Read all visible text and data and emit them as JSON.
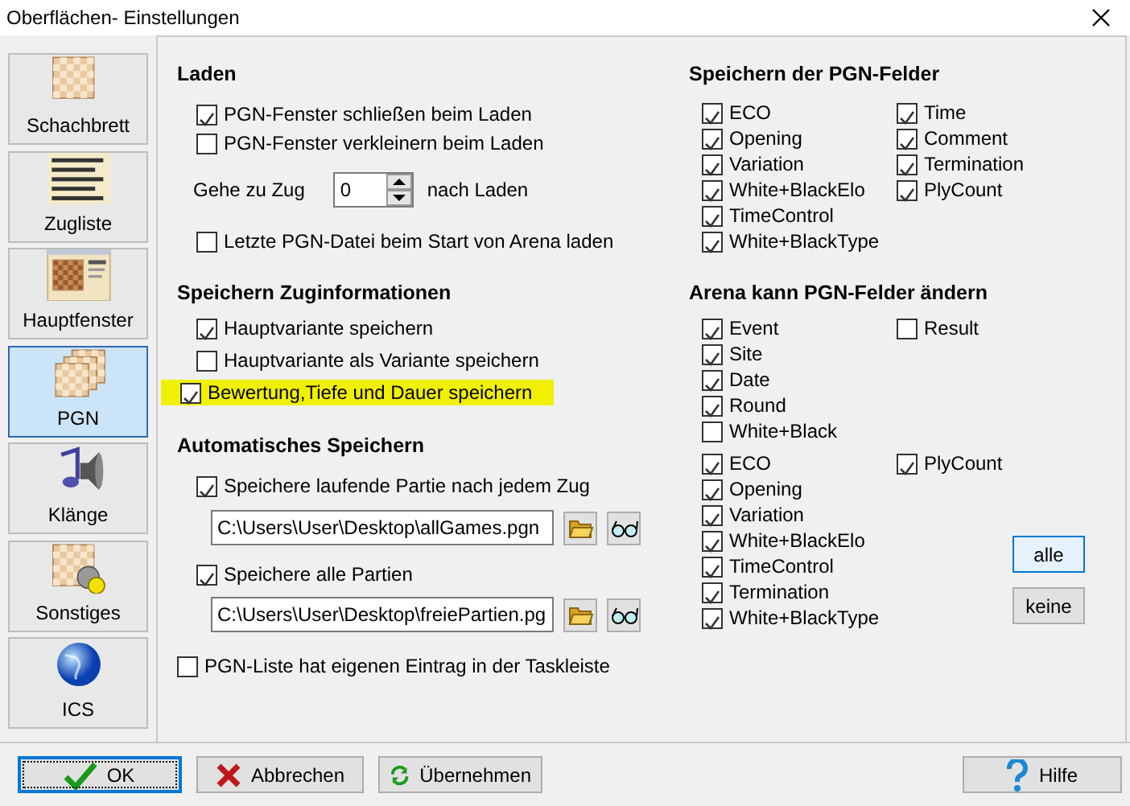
{
  "window": {
    "title": "Oberflächen- Einstellungen"
  },
  "sidebar": {
    "items": [
      {
        "label": "Schachbrett",
        "kind": "board",
        "selected": false
      },
      {
        "label": "Zugliste",
        "kind": "movelist",
        "selected": false
      },
      {
        "label": "Hauptfenster",
        "kind": "mainwindow",
        "selected": false
      },
      {
        "label": "PGN",
        "kind": "pgn",
        "selected": true
      },
      {
        "label": "Klänge",
        "kind": "sound",
        "selected": false
      },
      {
        "label": "Sonstiges",
        "kind": "misc",
        "selected": false
      },
      {
        "label": "ICS",
        "kind": "globe",
        "selected": false
      }
    ]
  },
  "load": {
    "heading": "Laden",
    "options": [
      {
        "label": "PGN-Fenster schließen beim Laden",
        "checked": true
      },
      {
        "label": "PGN-Fenster verkleinern beim Laden",
        "checked": false
      }
    ],
    "goto": {
      "label": "Gehe zu Zug",
      "value": "0",
      "suffix": "nach Laden"
    },
    "last_file": {
      "label": "Letzte PGN-Datei beim Start von Arena laden",
      "checked": false
    }
  },
  "move_info": {
    "heading": "Speichern Zuginformationen",
    "options": [
      {
        "label": "Hauptvariante speichern",
        "checked": true,
        "highlighted": false
      },
      {
        "label": "Hauptvariante als Variante speichern",
        "checked": false,
        "highlighted": false
      },
      {
        "label": "Bewertung,Tiefe und Dauer speichern",
        "checked": true,
        "highlighted": true
      }
    ]
  },
  "autosave": {
    "heading": "Automatisches Speichern",
    "entries": [
      {
        "label": "Speichere laufende Partie nach jedem Zug",
        "checked": true,
        "path": "C:\\Users\\User\\Desktop\\allGames.pgn"
      },
      {
        "label": "Speichere alle Partien",
        "checked": true,
        "path": "C:\\Users\\User\\Desktop\\freiePartien.pg"
      }
    ],
    "taskbar": {
      "label": "PGN-Liste hat eigenen Eintrag in der Taskleiste",
      "checked": false
    }
  },
  "save_fields": {
    "heading": "Speichern der PGN-Felder",
    "columns": [
      [
        {
          "label": "ECO",
          "checked": true
        },
        {
          "label": "Opening",
          "checked": true
        },
        {
          "label": "Variation",
          "checked": true
        },
        {
          "label": "White+BlackElo",
          "checked": true
        },
        {
          "label": "TimeControl",
          "checked": true
        },
        {
          "label": "White+BlackType",
          "checked": true
        }
      ],
      [
        {
          "label": "Time",
          "checked": true
        },
        {
          "label": "Comment",
          "checked": true
        },
        {
          "label": "Termination",
          "checked": true
        },
        {
          "label": "PlyCount",
          "checked": true
        }
      ]
    ]
  },
  "arena_fields": {
    "heading": "Arena kann PGN-Felder ändern",
    "groups": [
      {
        "columns": [
          [
            {
              "label": "Event",
              "checked": true
            },
            {
              "label": "Site",
              "checked": true
            },
            {
              "label": "Date",
              "checked": true
            },
            {
              "label": "Round",
              "checked": true
            },
            {
              "label": "White+Black",
              "checked": false
            }
          ],
          [
            {
              "label": "Result",
              "checked": false
            }
          ]
        ]
      },
      {
        "columns": [
          [
            {
              "label": "ECO",
              "checked": true
            },
            {
              "label": "Opening",
              "checked": true
            },
            {
              "label": "Variation",
              "checked": true
            },
            {
              "label": "White+BlackElo",
              "checked": true
            },
            {
              "label": "TimeControl",
              "checked": true
            },
            {
              "label": "Termination",
              "checked": true
            },
            {
              "label": "White+BlackType",
              "checked": true
            }
          ],
          [
            {
              "label": "PlyCount",
              "checked": true
            }
          ]
        ]
      }
    ],
    "buttons": [
      {
        "label": "alle",
        "focused": true
      },
      {
        "label": "keine",
        "focused": false
      }
    ]
  },
  "footer": {
    "buttons": [
      {
        "label": "OK",
        "kind": "ok",
        "focused": true
      },
      {
        "label": "Abbrechen",
        "kind": "cancel",
        "focused": false
      },
      {
        "label": "Übernehmen",
        "kind": "apply",
        "focused": false
      },
      {
        "label": "Hilfe",
        "kind": "help",
        "focused": false
      }
    ]
  }
}
